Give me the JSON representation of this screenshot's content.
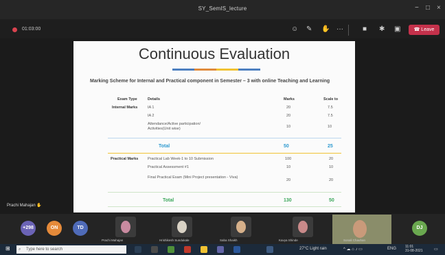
{
  "window": {
    "title": "SY_SemIS_lecture",
    "minimize": "−",
    "maximize": "□",
    "close": "×"
  },
  "toolbar": {
    "timer": "01:03:00",
    "leave_label": "Leave",
    "more": "···"
  },
  "slide": {
    "title": "Continuous Evaluation",
    "subtitle": "Marking Scheme for Internal and Practical component in Semester – 3 with online Teaching and Learning",
    "headers": {
      "type": "Exam Type",
      "details": "Details",
      "marks": "Marks",
      "scale": "Scale to"
    },
    "internal": {
      "label": "Internal Marks",
      "rows": [
        {
          "details": "IA 1",
          "marks": "20",
          "scale": "7.5"
        },
        {
          "details": "IA 2",
          "marks": "20",
          "scale": "7.5"
        },
        {
          "details": "Attendance/Active participation/ Activities(Unit wise)",
          "marks": "10",
          "scale": "10"
        }
      ],
      "total": {
        "label": "Total",
        "marks": "50",
        "scale": "25"
      }
    },
    "practical": {
      "label": "Practical Marks",
      "rows": [
        {
          "details": "Practical Lab Week-1 to 10 Submission",
          "marks": "100",
          "scale": "20"
        },
        {
          "details": "Practical Assessment #1",
          "marks": "10",
          "scale": "10"
        },
        {
          "details": "Final Practical Exam (Mini Project presentation - Viva)",
          "marks": "20",
          "scale": "20"
        }
      ],
      "total": {
        "label": "Total",
        "marks": "130",
        "scale": "50"
      }
    }
  },
  "presenter_name": "Prachi Mahajan",
  "participants": [
    {
      "initials": "+298",
      "color": "#6b63b5"
    },
    {
      "initials": "ON",
      "color": "#e58a3a"
    },
    {
      "initials": "TD",
      "color": "#4f6bb8"
    },
    {
      "name": "Prachi Mahajan"
    },
    {
      "name": "Hrishikesh Sundukale"
    },
    {
      "name": "Saba Shaikh"
    },
    {
      "name": "Kavya Shinde"
    },
    {
      "name": "Sonali Chauhan"
    },
    {
      "initials": "DJ",
      "color": "#6aa84f"
    }
  ],
  "taskbar": {
    "search_placeholder": "Type here to search",
    "weather": "27°C Light rain",
    "lang": "ENG",
    "time": "11:01",
    "date": "31-08-2021"
  }
}
